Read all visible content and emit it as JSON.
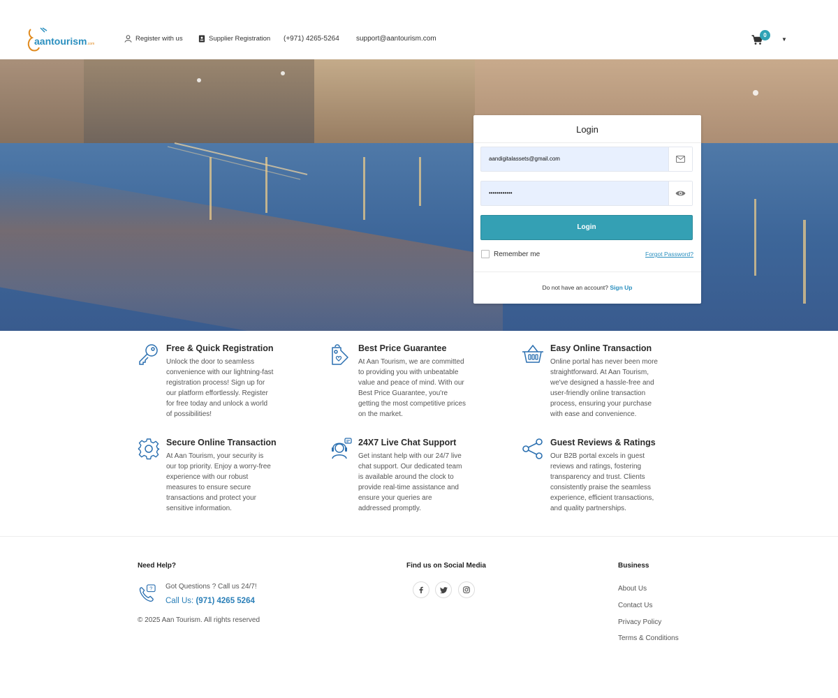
{
  "header": {
    "logo_text": "aantourism",
    "logo_suffix": ".com",
    "register_label": "Register with us",
    "supplier_label": "Supplier Registration",
    "phone": "(+971) 4265-5264",
    "email": "support@aantourism.com",
    "cart_count": "0"
  },
  "login": {
    "title": "Login",
    "email_value": "aandigitalassets@gmail.com",
    "password_value": "••••••••••••",
    "button_label": "Login",
    "remember_label": "Remember me",
    "forgot_label": "Forgot Password?",
    "no_account_text": "Do not have an account?",
    "signup_label": "Sign Up"
  },
  "features": [
    {
      "title": "Free & Quick Registration",
      "text": "Unlock the door to seamless convenience with our lightning-fast registration process! Sign up for our platform effortlessly. Register for free today and unlock a world of possibilities!",
      "icon": "key-icon"
    },
    {
      "title": "Best Price Guarantee",
      "text": "At Aan Tourism, we are committed to providing you with unbeatable value and peace of mind. With our Best Price Guarantee, you're getting the most competitive prices on the market.",
      "icon": "price-tag-icon"
    },
    {
      "title": "Easy Online Transaction",
      "text": "Online portal has never been more straightforward. At Aan Tourism, we've designed a hassle-free and user-friendly online transaction process, ensuring your purchase with ease and convenience.",
      "icon": "basket-icon"
    },
    {
      "title": "Secure Online Transaction",
      "text": "At Aan Tourism, your security is our top priority. Enjoy a worry-free experience with our robust measures to ensure secure transactions and protect your sensitive information.",
      "icon": "gear-icon"
    },
    {
      "title": "24X7 Live Chat Support",
      "text": "Get instant help with our 24/7 live chat support. Our dedicated team is available around the clock to provide real-time assistance and ensure your queries are addressed promptly.",
      "icon": "support-agent-icon"
    },
    {
      "title": "Guest Reviews & Ratings",
      "text": "Our B2B portal excels in guest reviews and ratings, fostering transparency and trust. Clients consistently praise the seamless experience, efficient transactions, and quality partnerships.",
      "icon": "share-icon"
    }
  ],
  "footer": {
    "help_heading": "Need Help?",
    "help_question": "Got Questions ? Call us 24/7!",
    "call_prefix": "Call Us:",
    "call_number": "(971) 4265 5264",
    "copyright": "© 2025 Aan Tourism. All rights reserved",
    "social_heading": "Find us on Social Media",
    "business_heading": "Business",
    "business_links": [
      "About Us",
      "Contact Us",
      "Privacy Policy",
      "Terms & Conditions"
    ]
  },
  "colors": {
    "accent": "#34a0b4",
    "link": "#2a8fbf",
    "icon_blue": "#2a6fb0"
  }
}
